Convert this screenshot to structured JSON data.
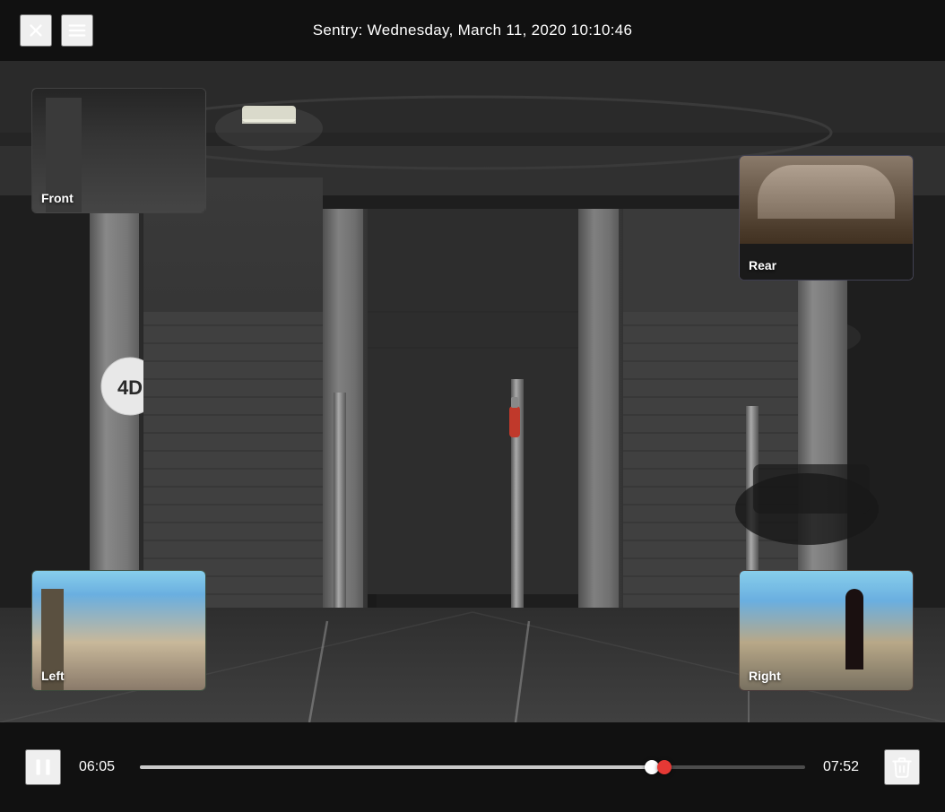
{
  "header": {
    "title": "Sentry: Wednesday, March 11, 2020 10:10:46"
  },
  "controls": {
    "current_time": "06:05",
    "total_time": "07:52",
    "progress_percent": 77,
    "play_pause_state": "playing"
  },
  "thumbnails": {
    "front": {
      "label": "Front",
      "position": "top-left"
    },
    "rear": {
      "label": "Rear",
      "position": "top-right"
    },
    "left": {
      "label": "Left",
      "position": "bottom-left"
    },
    "right": {
      "label": "Right",
      "position": "bottom-right"
    }
  },
  "icons": {
    "close": "×",
    "menu": "≡",
    "pause": "⏸",
    "delete": "🗑"
  }
}
